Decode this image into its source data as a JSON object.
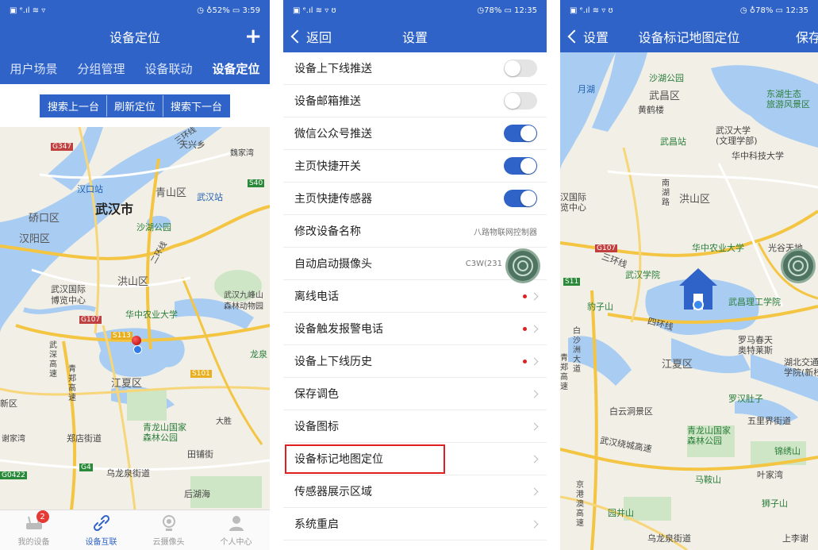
{
  "colors": {
    "primary": "#2f63c7",
    "toggle_on": "#2f63c7",
    "toggle_off": "#e4e4e4",
    "highlight": "#e02020"
  },
  "screen1": {
    "status": {
      "left": "▣ ᵉ.ıl ≋ ▿",
      "right": "◷ ♁52% ▭ 3:59"
    },
    "title": "设备定位",
    "add_icon": "plus-icon",
    "tabs": [
      {
        "label": "用户场景",
        "active": false
      },
      {
        "label": "分组管理",
        "active": false
      },
      {
        "label": "设备联动",
        "active": false
      },
      {
        "label": "设备定位",
        "active": true
      }
    ],
    "buttons": {
      "prev": "搜索上一台",
      "refresh": "刷新定位",
      "next": "搜索下一台"
    },
    "map_labels": {
      "wuhan": "武汉市",
      "hankou": "汉口站",
      "wuchang": "武汉站",
      "qingshan": "青山区",
      "tianxing": "天兴乡",
      "weijiazui": "魏家湾",
      "qiaokou": "硚口区",
      "hanyang": "汉阳区",
      "shahu": "沙湖公园",
      "hongshan": "洪山区",
      "expo": "武汉国际\n博览中心",
      "huanong": "华中农业大学",
      "jiangxia": "江夏区",
      "zhengdian": "郑店街道",
      "qinglong": "青龙山国家\n森林公园",
      "tianpu": "田铺街",
      "wulongquan": "乌龙泉街道",
      "houhuhai": "后湖海",
      "jiufeng": "武汉九峰山\n森林动物园",
      "longquan": "龙泉",
      "dajiawan": "谢家湾",
      "dajun": "大胜",
      "g347": "G347",
      "s40": "S40",
      "s101": "S101",
      "g107": "G107",
      "s113": "S113",
      "g4": "G4",
      "g0422": "G0422",
      "ring3": "三环线",
      "ring_e": "二环线",
      "qingyan": "青\n郑\n高\n速",
      "wushen": "武\n深\n高\n速",
      "xinqu": "新区"
    },
    "nav": [
      {
        "label": "我的设备",
        "icon": "router-icon",
        "badge": "2",
        "active": false
      },
      {
        "label": "设备互联",
        "icon": "link-icon",
        "active": true
      },
      {
        "label": "云摄像头",
        "icon": "camera-icon",
        "active": false
      },
      {
        "label": "个人中心",
        "icon": "person-icon",
        "active": false
      }
    ]
  },
  "screen2": {
    "status": {
      "left": "▣ ᵉ.ıl ≋ ▿ ʊ",
      "right": "◷78% ▭ 12:35"
    },
    "back": "返回",
    "title": "设置",
    "rows": [
      {
        "label": "设备上下线推送",
        "kind": "toggle",
        "on": false
      },
      {
        "label": "设备邮箱推送",
        "kind": "toggle",
        "on": false
      },
      {
        "label": "微信公众号推送",
        "kind": "toggle",
        "on": true
      },
      {
        "label": "主页快捷开关",
        "kind": "toggle",
        "on": true
      },
      {
        "label": "主页快捷传感器",
        "kind": "toggle",
        "on": true
      },
      {
        "label": "修改设备名称",
        "kind": "value",
        "value": "八路物联网控制器"
      },
      {
        "label": "自动启动摄像头",
        "kind": "value",
        "value": "C3W(231"
      },
      {
        "label": "离线电话",
        "kind": "dot"
      },
      {
        "label": "设备触发报警电话",
        "kind": "dot"
      },
      {
        "label": "设备上下线历史",
        "kind": "dot"
      },
      {
        "label": "保存调色",
        "kind": "chev"
      },
      {
        "label": "设备图标",
        "kind": "chev"
      },
      {
        "label": "设备标记地图定位",
        "kind": "chev",
        "highlight": true
      },
      {
        "label": "传感器展示区域",
        "kind": "chev"
      },
      {
        "label": "系统重启",
        "kind": "chev"
      }
    ]
  },
  "screen3": {
    "status": {
      "left": "▣ ᵉ.ıl ≋ ▿ ʊ",
      "right": "◷ ♁78% ▭ 12:35"
    },
    "back": "设置",
    "title": "设备标记地图定位",
    "save": "保存",
    "map_labels": {
      "shahu": "沙湖公园",
      "yuehu": "月湖",
      "wuchang": "武昌区",
      "huanghelou": "黄鹤楼",
      "donghu": "东湖生态\n旅游风景区",
      "whu": "武汉大学\n(文理学部)",
      "wuchang_st": "武昌站",
      "hust": "华中科技大学",
      "hongshan": "洪山区",
      "expo": "汉国际\n览中心",
      "nanhu": "南\n湖\n路",
      "huanong": "华中农业大学",
      "guanggu": "光谷天地",
      "wuhan_coll": "武汉学院",
      "ring3": "三环线",
      "baozishan": "豹子山",
      "ring4": "四环线",
      "wcit": "武昌理工学院",
      "romantic": "罗马春天\n奥特莱斯",
      "jiangxia": "江夏区",
      "hubei_trans": "湖北交通\n学院(新校",
      "baiyun": "白云洞景区",
      "luohanshi": "罗汉肚子",
      "wujie": "五里界街道",
      "qinglong": "青龙山国家\n森林公园",
      "raoyue": "武汉绕城高速",
      "jinxiu": "锦绣山",
      "maanshan": "马鞍山",
      "yejiawan": "叶家湾",
      "shizi": "狮子山",
      "yuanjing": "园井山",
      "wulongquan": "乌龙泉街道",
      "shangli": "上李谢",
      "g107": "G107",
      "s11": "S11",
      "jinggang": "京\n港\n澳\n高\n速",
      "baisha": "白\n沙\n洲\n大\n道",
      "qingzheng": "青\n郑\n高\n速"
    }
  }
}
